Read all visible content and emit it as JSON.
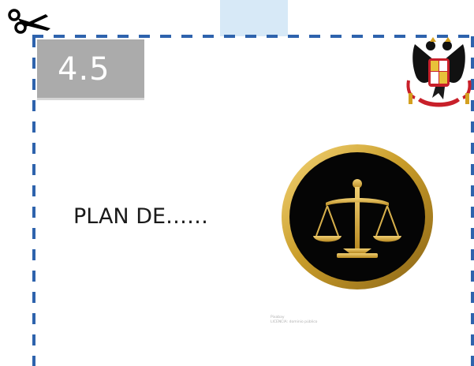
{
  "card": {
    "section_number": "4.5",
    "heading": "PLAN DE……",
    "image_caption_line1": "Pixabay",
    "image_caption_line2": "LICENCIA: dominio público"
  },
  "colors": {
    "dashed_border": "#2e63ad",
    "badge_background": "#ababab",
    "badge_text": "#ffffff",
    "tab_strip": "#d7e9f7",
    "heading_text": "#1a1a1a",
    "emblem_gold": "#c99d2a",
    "emblem_fill": "#050505"
  },
  "icons": {
    "cut_marker": "scissors-icon",
    "institution_emblem": "coat-of-arms-icon",
    "justice_emblem": "balance-scale-icon"
  }
}
